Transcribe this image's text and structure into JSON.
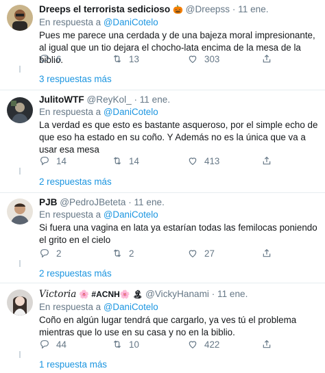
{
  "tweets": [
    {
      "name": "Dreeps el terrorista sedicioso",
      "emoji": "🎃",
      "handle": "@Dreepss",
      "date": "11 ene.",
      "reply_prefix": "En respuesta a",
      "reply_to": "@DaniCotelo",
      "text": "Pues me parece una cerdada y de una bajeza moral impresionante, al igual que un tio dejara el chocho-lata encima de la mesa de la biblio.",
      "replies": "6",
      "retweets": "13",
      "likes": "303",
      "more_replies": "3 respuestas más"
    },
    {
      "name": "JulitoWTF",
      "emoji": "",
      "handle": "@ReyKol_",
      "date": "11 ene.",
      "reply_prefix": "En respuesta a",
      "reply_to": "@DaniCotelo",
      "text": "La verdad es que esto es bastante asqueroso, por el simple echo de que eso ha estado en su coño. Y Además no es la única que va a usar esa mesa",
      "replies": "14",
      "retweets": "14",
      "likes": "413",
      "more_replies": "2 respuestas más"
    },
    {
      "name": "PJB",
      "emoji": "",
      "handle": "@PedroJBeteta",
      "date": "11 ene.",
      "reply_prefix": "En respuesta a",
      "reply_to": "@DaniCotelo",
      "text": "Si fuera una vagina en lata ya estarían todas las femilocas poniendo el grito en el cielo",
      "replies": "2",
      "retweets": "2",
      "likes": "27",
      "more_replies": "2 respuestas más"
    },
    {
      "name": "𝑉𝑖𝑐𝑡𝑜𝑟𝑖𝑎",
      "emoji": "🌸 #ACNH🌸 🏝",
      "handle": "@VickyHanami",
      "date": "11 ene.",
      "reply_prefix": "En respuesta a",
      "reply_to": "@DaniCotelo",
      "text": "Coño en algún lugar tendrá que cargarlo, ya ves tú el problema mientras que lo use en su casa y no en la biblio.",
      "replies": "44",
      "retweets": "10",
      "likes": "422",
      "more_replies": "1 respuesta más"
    }
  ],
  "icons": {
    "reply": "reply-icon",
    "retweet": "retweet-icon",
    "like": "heart-icon",
    "share": "share-icon"
  },
  "colors": {
    "link": "#1b95e0",
    "muted": "#657786",
    "border": "#e6ecf0"
  }
}
